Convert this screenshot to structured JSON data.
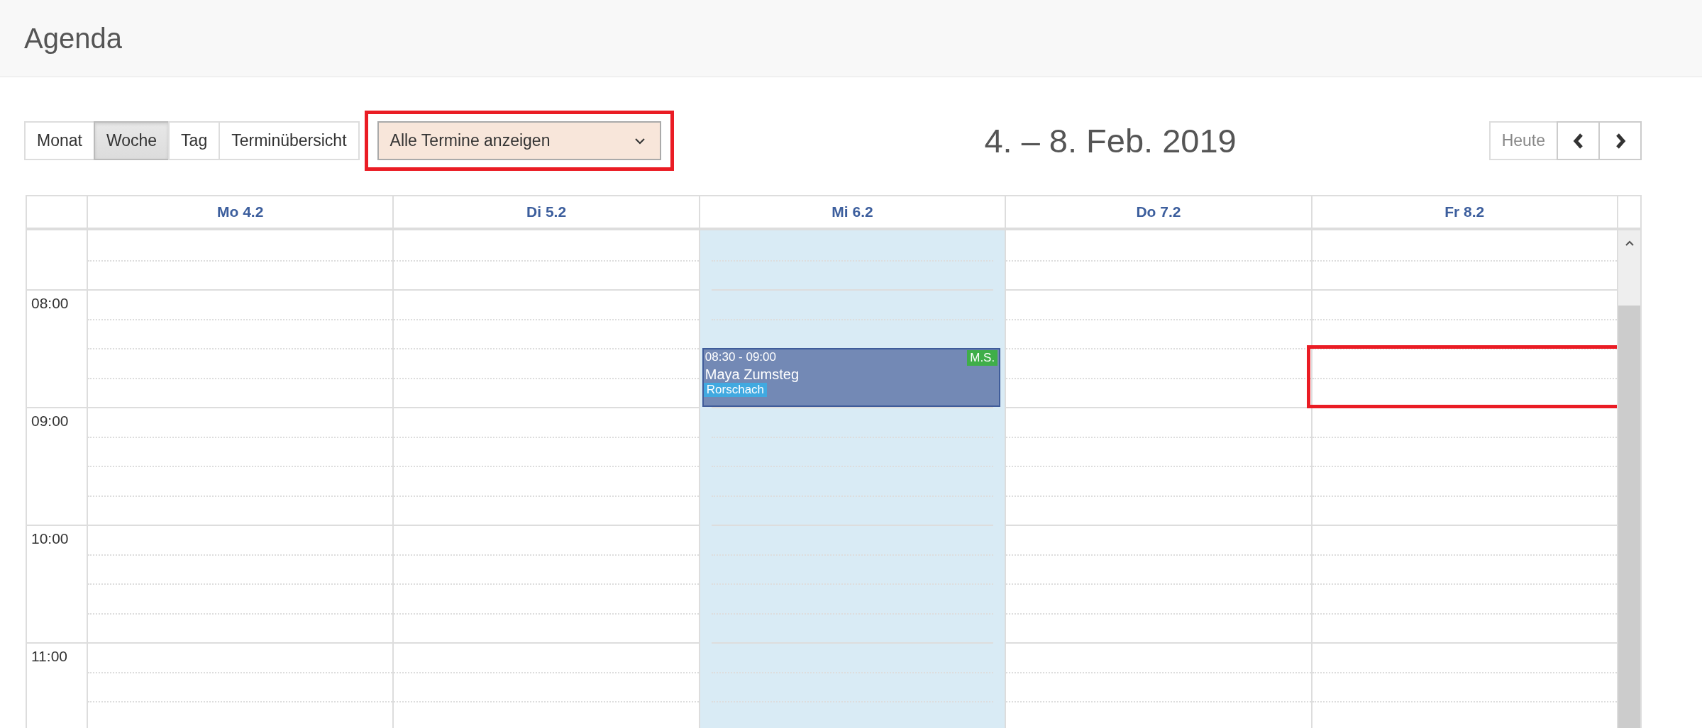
{
  "page_title": "Agenda",
  "views": [
    {
      "label": "Monat",
      "selected": false
    },
    {
      "label": "Woche",
      "selected": true
    },
    {
      "label": "Tag",
      "selected": false
    },
    {
      "label": "Terminübersicht",
      "selected": false
    }
  ],
  "filter": {
    "value": "Alle Termine anzeigen",
    "highlighted": true
  },
  "date_range": "4. – 8. Feb. 2019",
  "today_button": "Heute",
  "hours": [
    "08:00",
    "09:00",
    "10:00",
    "11:00"
  ],
  "days": [
    {
      "label": "Mo 4.2",
      "selected": false,
      "annotated": false
    },
    {
      "label": "Di 5.2",
      "selected": false,
      "annotated": false
    },
    {
      "label": "Mi 6.2",
      "selected": true,
      "annotated": false,
      "events": [
        {
          "time": "08:30 - 09:00",
          "title": "Maya Zumsteg",
          "initials": "M.S.",
          "location": "Rorschach"
        }
      ]
    },
    {
      "label": "Do 7.2",
      "selected": false,
      "annotated": false
    },
    {
      "label": "Fr 8.2",
      "selected": false,
      "annotated": true
    }
  ]
}
